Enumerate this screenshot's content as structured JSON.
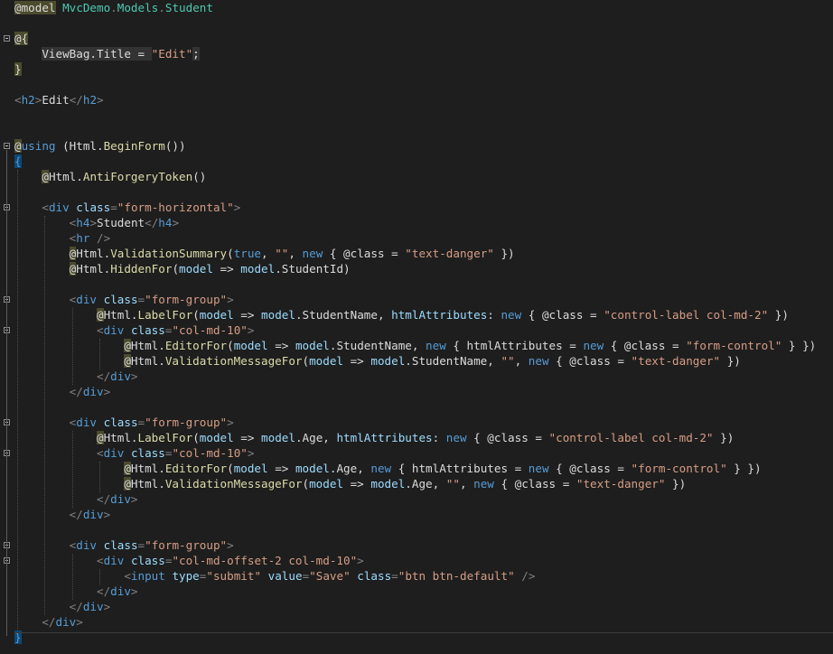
{
  "editor": {
    "lines": [
      {
        "y": 0,
        "code": [
          [
            "razor",
            "@model"
          ],
          [
            "txt",
            " "
          ],
          [
            "type",
            "MvcDemo"
          ],
          [
            "punct",
            "."
          ],
          [
            "type",
            "Models"
          ],
          [
            "punct",
            "."
          ],
          [
            "type",
            "Student"
          ]
        ]
      },
      {
        "y": 2,
        "code": [
          [
            "razor",
            "@{"
          ]
        ]
      },
      {
        "y": 3,
        "code": [
          [
            "txt",
            "    "
          ],
          [
            "hl",
            "ViewBag.Title = "
          ],
          [
            "str",
            "\"Edit\""
          ],
          [
            "hl",
            ";"
          ]
        ]
      },
      {
        "y": 4,
        "code": [
          [
            "razor",
            "}"
          ]
        ]
      },
      {
        "y": 6,
        "code": [
          [
            "punct",
            "<"
          ],
          [
            "tag",
            "h2"
          ],
          [
            "punct",
            ">"
          ],
          [
            "txt",
            "Edit"
          ],
          [
            "punct",
            "</"
          ],
          [
            "tag",
            "h2"
          ],
          [
            "punct",
            ">"
          ]
        ]
      },
      {
        "y": 9,
        "code": [
          [
            "razor",
            "@"
          ],
          [
            "kw",
            "using"
          ],
          [
            "txt",
            " (Html."
          ],
          [
            "method",
            "BeginForm"
          ],
          [
            "txt",
            "())"
          ]
        ]
      },
      {
        "y": 10,
        "code": [
          [
            "brace",
            "{"
          ]
        ]
      },
      {
        "y": 11,
        "code": [
          [
            "txt",
            "    "
          ],
          [
            "razor",
            "@"
          ],
          [
            "txt",
            "Html."
          ],
          [
            "method",
            "AntiForgeryToken"
          ],
          [
            "txt",
            "()"
          ]
        ]
      },
      {
        "y": 13,
        "code": [
          [
            "txt",
            "    "
          ],
          [
            "punct",
            "<"
          ],
          [
            "tag",
            "div"
          ],
          [
            "txt",
            " "
          ],
          [
            "attr",
            "class"
          ],
          [
            "punct",
            "="
          ],
          [
            "str",
            "\"form-horizontal\""
          ],
          [
            "punct",
            ">"
          ]
        ]
      },
      {
        "y": 14,
        "code": [
          [
            "txt",
            "        "
          ],
          [
            "punct",
            "<"
          ],
          [
            "tag",
            "h4"
          ],
          [
            "punct",
            ">"
          ],
          [
            "txt",
            "Student"
          ],
          [
            "punct",
            "</"
          ],
          [
            "tag",
            "h4"
          ],
          [
            "punct",
            ">"
          ]
        ]
      },
      {
        "y": 15,
        "code": [
          [
            "txt",
            "        "
          ],
          [
            "punct",
            "<"
          ],
          [
            "tag",
            "hr"
          ],
          [
            "txt",
            " "
          ],
          [
            "punct",
            "/>"
          ]
        ]
      },
      {
        "y": 16,
        "code": [
          [
            "txt",
            "        "
          ],
          [
            "razor",
            "@"
          ],
          [
            "txt",
            "Html."
          ],
          [
            "method",
            "ValidationSummary"
          ],
          [
            "txt",
            "("
          ],
          [
            "kw",
            "true"
          ],
          [
            "txt",
            ", "
          ],
          [
            "str",
            "\"\""
          ],
          [
            "txt",
            ", "
          ],
          [
            "kw",
            "new"
          ],
          [
            "txt",
            " { @class = "
          ],
          [
            "str",
            "\"text-danger\""
          ],
          [
            "txt",
            " })"
          ]
        ]
      },
      {
        "y": 17,
        "code": [
          [
            "txt",
            "        "
          ],
          [
            "razor",
            "@"
          ],
          [
            "txt",
            "Html."
          ],
          [
            "method",
            "HiddenFor"
          ],
          [
            "txt",
            "("
          ],
          [
            "prop",
            "model"
          ],
          [
            "txt",
            " => "
          ],
          [
            "prop",
            "model"
          ],
          [
            "txt",
            ".StudentId)"
          ]
        ]
      },
      {
        "y": 19,
        "code": [
          [
            "txt",
            "        "
          ],
          [
            "punct",
            "<"
          ],
          [
            "tag",
            "div"
          ],
          [
            "txt",
            " "
          ],
          [
            "attr",
            "class"
          ],
          [
            "punct",
            "="
          ],
          [
            "str",
            "\"form-group\""
          ],
          [
            "punct",
            ">"
          ]
        ]
      },
      {
        "y": 20,
        "code": [
          [
            "txt",
            "            "
          ],
          [
            "razor",
            "@"
          ],
          [
            "txt",
            "Html."
          ],
          [
            "method",
            "LabelFor"
          ],
          [
            "txt",
            "("
          ],
          [
            "prop",
            "model"
          ],
          [
            "txt",
            " => "
          ],
          [
            "prop",
            "model"
          ],
          [
            "txt",
            ".StudentName, "
          ],
          [
            "prop",
            "htmlAttributes"
          ],
          [
            "txt",
            ": "
          ],
          [
            "kw",
            "new"
          ],
          [
            "txt",
            " { @class = "
          ],
          [
            "str",
            "\"control-label col-md-2\""
          ],
          [
            "txt",
            " })"
          ]
        ]
      },
      {
        "y": 21,
        "code": [
          [
            "txt",
            "            "
          ],
          [
            "punct",
            "<"
          ],
          [
            "tag",
            "div"
          ],
          [
            "txt",
            " "
          ],
          [
            "attr",
            "class"
          ],
          [
            "punct",
            "="
          ],
          [
            "str",
            "\"col-md-10\""
          ],
          [
            "punct",
            ">"
          ]
        ]
      },
      {
        "y": 22,
        "code": [
          [
            "txt",
            "                "
          ],
          [
            "razor",
            "@"
          ],
          [
            "txt",
            "Html."
          ],
          [
            "method",
            "EditorFor"
          ],
          [
            "txt",
            "("
          ],
          [
            "prop",
            "model"
          ],
          [
            "txt",
            " => "
          ],
          [
            "prop",
            "model"
          ],
          [
            "txt",
            ".StudentName, "
          ],
          [
            "kw",
            "new"
          ],
          [
            "txt",
            " { htmlAttributes = "
          ],
          [
            "kw",
            "new"
          ],
          [
            "txt",
            " { @class = "
          ],
          [
            "str",
            "\"form-control\""
          ],
          [
            "txt",
            " } })"
          ]
        ]
      },
      {
        "y": 23,
        "code": [
          [
            "txt",
            "                "
          ],
          [
            "razor",
            "@"
          ],
          [
            "txt",
            "Html."
          ],
          [
            "method",
            "ValidationMessageFor"
          ],
          [
            "txt",
            "("
          ],
          [
            "prop",
            "model"
          ],
          [
            "txt",
            " => "
          ],
          [
            "prop",
            "model"
          ],
          [
            "txt",
            ".StudentName, "
          ],
          [
            "str",
            "\"\""
          ],
          [
            "txt",
            ", "
          ],
          [
            "kw",
            "new"
          ],
          [
            "txt",
            " { @class = "
          ],
          [
            "str",
            "\"text-danger\""
          ],
          [
            "txt",
            " })"
          ]
        ]
      },
      {
        "y": 24,
        "code": [
          [
            "txt",
            "            "
          ],
          [
            "punct",
            "</"
          ],
          [
            "tag",
            "div"
          ],
          [
            "punct",
            ">"
          ]
        ]
      },
      {
        "y": 25,
        "code": [
          [
            "txt",
            "        "
          ],
          [
            "punct",
            "</"
          ],
          [
            "tag",
            "div"
          ],
          [
            "punct",
            ">"
          ]
        ]
      },
      {
        "y": 27,
        "code": [
          [
            "txt",
            "        "
          ],
          [
            "punct",
            "<"
          ],
          [
            "tag",
            "div"
          ],
          [
            "txt",
            " "
          ],
          [
            "attr",
            "class"
          ],
          [
            "punct",
            "="
          ],
          [
            "str",
            "\"form-group\""
          ],
          [
            "punct",
            ">"
          ]
        ]
      },
      {
        "y": 28,
        "code": [
          [
            "txt",
            "            "
          ],
          [
            "razor",
            "@"
          ],
          [
            "txt",
            "Html."
          ],
          [
            "method",
            "LabelFor"
          ],
          [
            "txt",
            "("
          ],
          [
            "prop",
            "model"
          ],
          [
            "txt",
            " => "
          ],
          [
            "prop",
            "model"
          ],
          [
            "txt",
            ".Age, "
          ],
          [
            "prop",
            "htmlAttributes"
          ],
          [
            "txt",
            ": "
          ],
          [
            "kw",
            "new"
          ],
          [
            "txt",
            " { @class = "
          ],
          [
            "str",
            "\"control-label col-md-2\""
          ],
          [
            "txt",
            " })"
          ]
        ]
      },
      {
        "y": 29,
        "code": [
          [
            "txt",
            "            "
          ],
          [
            "punct",
            "<"
          ],
          [
            "tag",
            "div"
          ],
          [
            "txt",
            " "
          ],
          [
            "attr",
            "class"
          ],
          [
            "punct",
            "="
          ],
          [
            "str",
            "\"col-md-10\""
          ],
          [
            "punct",
            ">"
          ]
        ]
      },
      {
        "y": 30,
        "code": [
          [
            "txt",
            "                "
          ],
          [
            "razor",
            "@"
          ],
          [
            "txt",
            "Html."
          ],
          [
            "method",
            "EditorFor"
          ],
          [
            "txt",
            "("
          ],
          [
            "prop",
            "model"
          ],
          [
            "txt",
            " => "
          ],
          [
            "prop",
            "model"
          ],
          [
            "txt",
            ".Age, "
          ],
          [
            "kw",
            "new"
          ],
          [
            "txt",
            " { htmlAttributes = "
          ],
          [
            "kw",
            "new"
          ],
          [
            "txt",
            " { @class = "
          ],
          [
            "str",
            "\"form-control\""
          ],
          [
            "txt",
            " } })"
          ]
        ]
      },
      {
        "y": 31,
        "code": [
          [
            "txt",
            "                "
          ],
          [
            "razor",
            "@"
          ],
          [
            "txt",
            "Html."
          ],
          [
            "method",
            "ValidationMessageFor"
          ],
          [
            "txt",
            "("
          ],
          [
            "prop",
            "model"
          ],
          [
            "txt",
            " => "
          ],
          [
            "prop",
            "model"
          ],
          [
            "txt",
            ".Age, "
          ],
          [
            "str",
            "\"\""
          ],
          [
            "txt",
            ", "
          ],
          [
            "kw",
            "new"
          ],
          [
            "txt",
            " { @class = "
          ],
          [
            "str",
            "\"text-danger\""
          ],
          [
            "txt",
            " })"
          ]
        ]
      },
      {
        "y": 32,
        "code": [
          [
            "txt",
            "            "
          ],
          [
            "punct",
            "</"
          ],
          [
            "tag",
            "div"
          ],
          [
            "punct",
            ">"
          ]
        ]
      },
      {
        "y": 33,
        "code": [
          [
            "txt",
            "        "
          ],
          [
            "punct",
            "</"
          ],
          [
            "tag",
            "div"
          ],
          [
            "punct",
            ">"
          ]
        ]
      },
      {
        "y": 35,
        "code": [
          [
            "txt",
            "        "
          ],
          [
            "punct",
            "<"
          ],
          [
            "tag",
            "div"
          ],
          [
            "txt",
            " "
          ],
          [
            "attr",
            "class"
          ],
          [
            "punct",
            "="
          ],
          [
            "str",
            "\"form-group\""
          ],
          [
            "punct",
            ">"
          ]
        ]
      },
      {
        "y": 36,
        "code": [
          [
            "txt",
            "            "
          ],
          [
            "punct",
            "<"
          ],
          [
            "tag",
            "div"
          ],
          [
            "txt",
            " "
          ],
          [
            "attr",
            "class"
          ],
          [
            "punct",
            "="
          ],
          [
            "str",
            "\"col-md-offset-2 col-md-10\""
          ],
          [
            "punct",
            ">"
          ]
        ]
      },
      {
        "y": 37,
        "code": [
          [
            "txt",
            "                "
          ],
          [
            "punct",
            "<"
          ],
          [
            "tag",
            "input"
          ],
          [
            "txt",
            " "
          ],
          [
            "attr",
            "type"
          ],
          [
            "punct",
            "="
          ],
          [
            "str",
            "\"submit\""
          ],
          [
            "txt",
            " "
          ],
          [
            "attr",
            "value"
          ],
          [
            "punct",
            "="
          ],
          [
            "str",
            "\"Save\""
          ],
          [
            "txt",
            " "
          ],
          [
            "attr",
            "class"
          ],
          [
            "punct",
            "="
          ],
          [
            "str",
            "\"btn btn-default\""
          ],
          [
            "txt",
            " "
          ],
          [
            "punct",
            "/>"
          ]
        ]
      },
      {
        "y": 38,
        "code": [
          [
            "txt",
            "            "
          ],
          [
            "punct",
            "</"
          ],
          [
            "tag",
            "div"
          ],
          [
            "punct",
            ">"
          ]
        ]
      },
      {
        "y": 39,
        "code": [
          [
            "txt",
            "        "
          ],
          [
            "punct",
            "</"
          ],
          [
            "tag",
            "div"
          ],
          [
            "punct",
            ">"
          ]
        ]
      },
      {
        "y": 40,
        "code": [
          [
            "txt",
            "    "
          ],
          [
            "punct",
            "</"
          ],
          [
            "tag",
            "div"
          ],
          [
            "punct",
            ">"
          ]
        ]
      },
      {
        "y": 41,
        "code": [
          [
            "brace",
            "}"
          ]
        ]
      }
    ],
    "folds": [
      {
        "y": 2,
        "end": 4
      },
      {
        "y": 9,
        "end": 41
      },
      {
        "y": 13,
        "end": 40
      },
      {
        "y": 19,
        "end": 25
      },
      {
        "y": 21,
        "end": 24
      },
      {
        "y": 27,
        "end": 33
      },
      {
        "y": 29,
        "end": 32
      },
      {
        "y": 35,
        "end": 39
      },
      {
        "y": 36,
        "end": 38
      }
    ],
    "colors": {
      "background": "#1e1e1e",
      "keyword": "#569cd6",
      "string": "#d69d85",
      "method": "#dcdcaa",
      "type": "#4ec9b0",
      "attribute": "#9cdcfe",
      "razor_highlight": "#4b4b2e"
    }
  }
}
